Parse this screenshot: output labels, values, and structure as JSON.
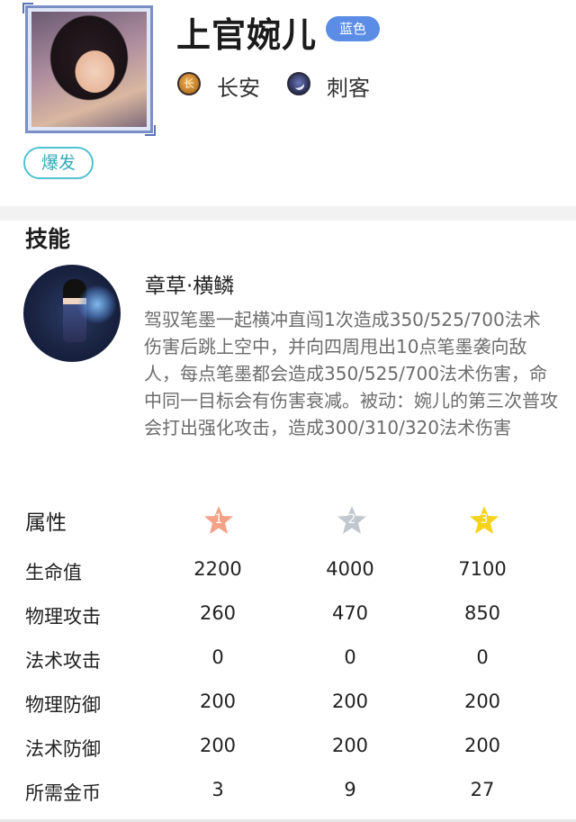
{
  "hero": {
    "name": "上官婉儿",
    "quality": "蓝色",
    "faction": "长安",
    "role": "刺客",
    "tag": "爆发"
  },
  "skills": {
    "section_title": "技能",
    "skill_name": "章草·横鳞",
    "skill_desc": "驾驭笔墨一起横冲直闯1次造成350/525/700法术伤害后跳上空中，并向四周甩出10点笔墨袭向敌人，每点笔墨都会造成350/525/700法术伤害，命中同一目标会有伤害衰减。被动：婉儿的第三次普攻会打出强化攻击，造成300/310/320法术伤害"
  },
  "attributes": {
    "title": "属性",
    "stars": [
      {
        "label": "1",
        "color": "#f4a287"
      },
      {
        "label": "2",
        "color": "#c1c7cf"
      },
      {
        "label": "3",
        "color": "#f7d21c"
      }
    ],
    "rows": [
      {
        "label": "生命值",
        "values": [
          "2200",
          "4000",
          "7100"
        ]
      },
      {
        "label": "物理攻击",
        "values": [
          "260",
          "470",
          "850"
        ]
      },
      {
        "label": "法术攻击",
        "values": [
          "0",
          "0",
          "0"
        ]
      },
      {
        "label": "物理防御",
        "values": [
          "200",
          "200",
          "200"
        ]
      },
      {
        "label": "法术防御",
        "values": [
          "200",
          "200",
          "200"
        ]
      },
      {
        "label": "所需金币",
        "values": [
          "3",
          "9",
          "27"
        ]
      }
    ]
  }
}
